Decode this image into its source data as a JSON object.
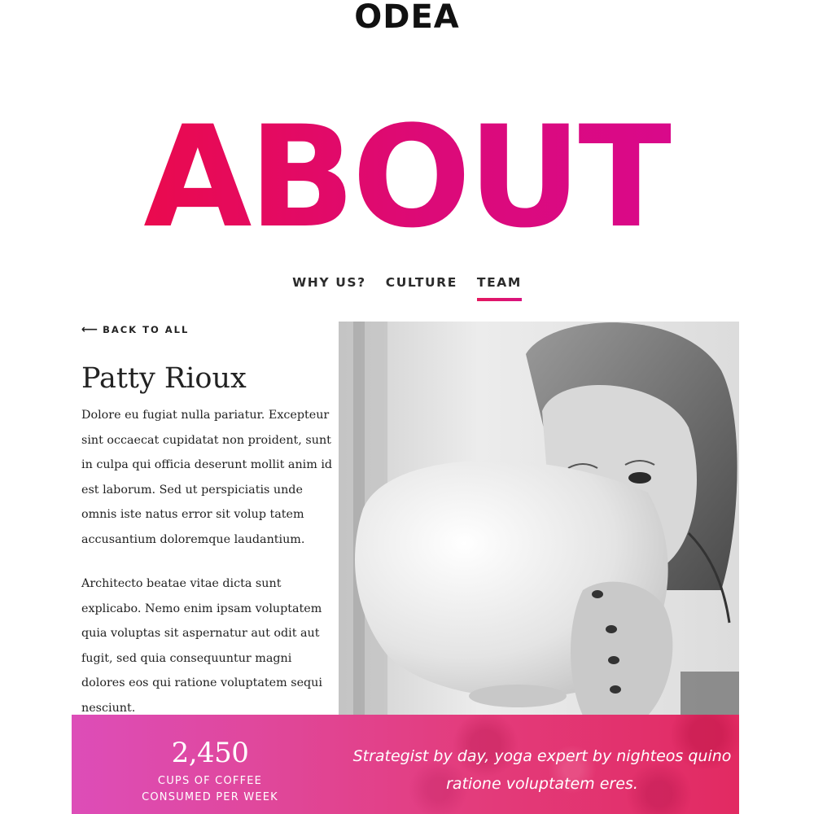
{
  "brand": {
    "logo": "ODEA"
  },
  "hero": {
    "title": "ABOUT"
  },
  "tabs": [
    {
      "label": "WHY US?",
      "active": false
    },
    {
      "label": "CULTURE",
      "active": false
    },
    {
      "label": "TEAM",
      "active": true
    }
  ],
  "nav": {
    "back_label": "BACK TO ALL",
    "back_icon": "arrow-left-icon"
  },
  "profile": {
    "name": "Patty Rioux",
    "bio_paragraphs": [
      "Dolore eu fugiat nulla pariatur. Excepteur sint occaecat cupidatat non proident, sunt in culpa qui officia deserunt mollit anim id est laborum. Sed ut perspiciatis unde omnis iste natus error sit volup tatem accusantium doloremque laudantium.",
      "Architecto beatae vitae dicta sunt explicabo. Nemo enim ipsam voluptatem quia voluptas sit aspernatur aut odit aut fugit, sed quia consequuntur magni dolores eos qui ratione voluptatem sequi nesciunt."
    ]
  },
  "stats": {
    "number": "2,450",
    "label_line1": "CUPS OF COFFEE",
    "label_line2": "CONSUMED PER WEEK"
  },
  "quote": "Strategist by day, yoga expert by nighteos quino ratione voluptatem eres.",
  "colors": {
    "accent_start": "#ea0a4e",
    "accent_end": "#d9098a",
    "band_start": "#dd4db8",
    "band_end": "#e22a62"
  }
}
